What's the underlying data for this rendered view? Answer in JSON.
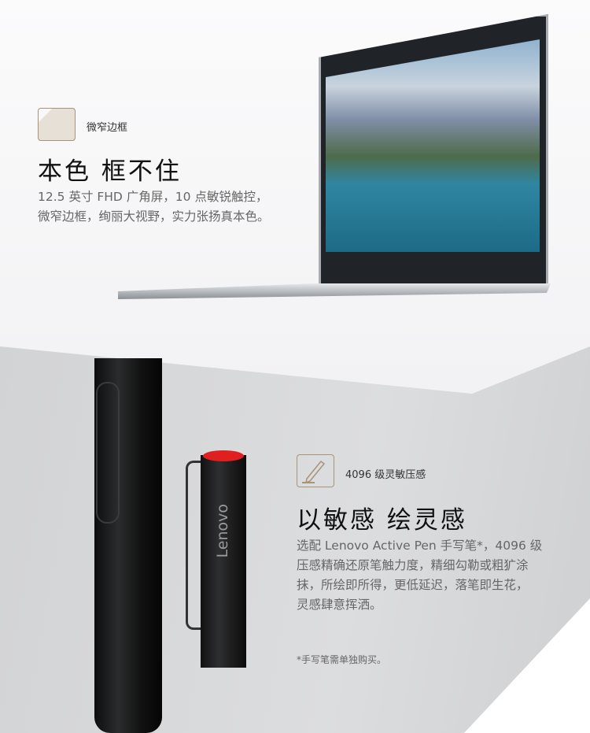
{
  "section1": {
    "feature_label": "微窄边框",
    "heading": "本色 框不住",
    "body_lines": [
      "12.5 英寸 FHD 广角屏，10 点敏锐触控，",
      "微窄边框，绚丽大视野，实力张扬真本色。"
    ]
  },
  "section2": {
    "feature_label": "4096 级灵敏压感",
    "heading": "以敏感 绘灵感",
    "body_lines": [
      "选配 Lenovo Active Pen 手写笔*，4096 级",
      "压感精确还原笔触力度，精细勾勒或粗犷涂",
      "抹，所绘即所得，更低延迟，落笔即生花，",
      "灵感肆意挥洒。"
    ],
    "footnote": "*手写笔需单独购买。",
    "pen_brand": "Lenovo"
  }
}
